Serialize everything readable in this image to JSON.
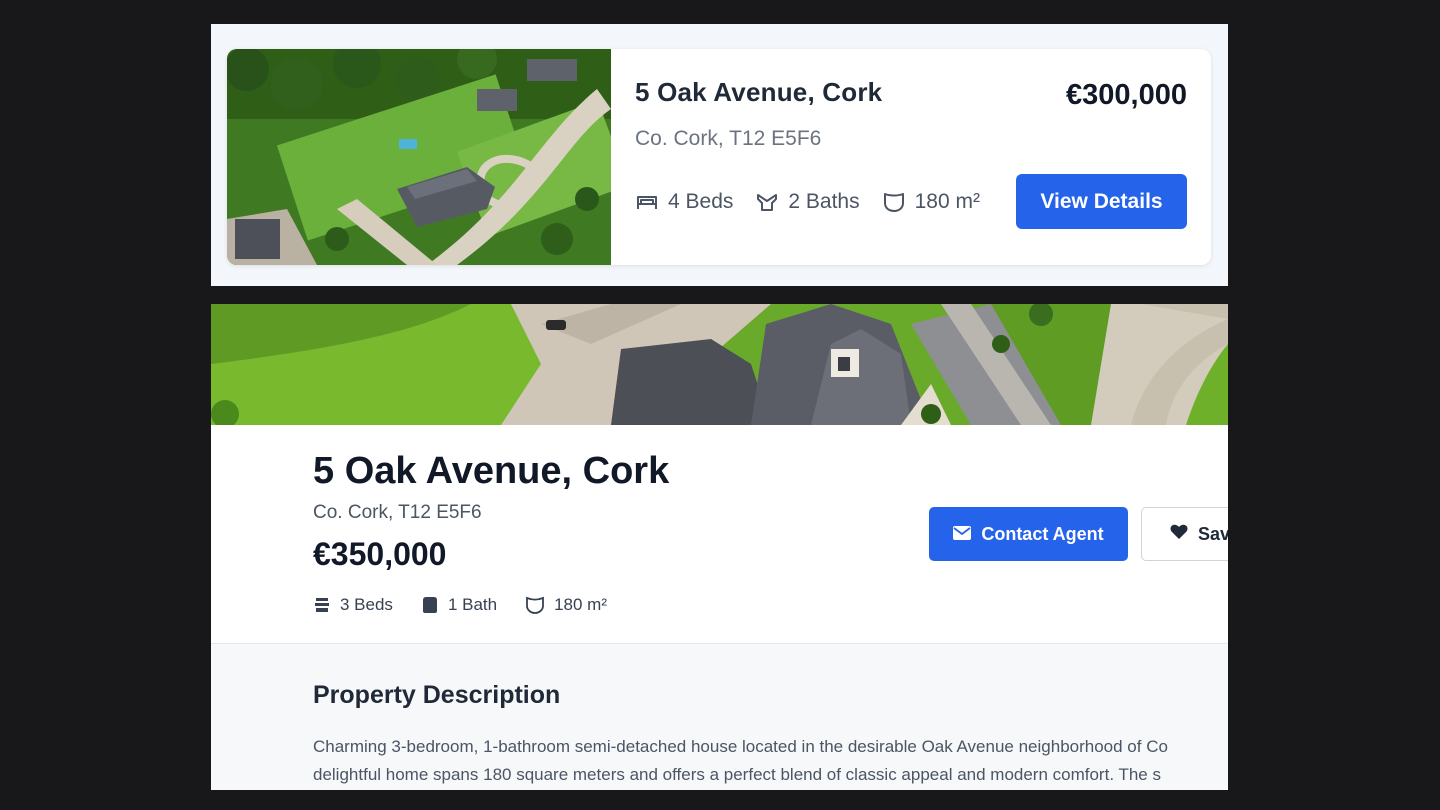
{
  "listing_card": {
    "address": "5 Oak Avenue, Cork",
    "subtitle": "Co. Cork, T12 E5F6",
    "price": "€300,000",
    "specs": {
      "beds": "4 Beds",
      "baths": "2 Baths",
      "area": "180 m²"
    },
    "view_button": "View Details",
    "icons": [
      "bed-icon",
      "bath-icon",
      "area-icon"
    ],
    "thumbnail": "aerial-estate-photo"
  },
  "detail_page": {
    "hero": "aerial-house-photo",
    "title": "5 Oak Avenue, Cork",
    "subtitle": "Co. Cork, T12 E5F6",
    "price": "€350,000",
    "specs": {
      "beds": "3 Beds",
      "baths": "1 Bath",
      "area": "180 m²"
    },
    "contact_button": "Contact Agent",
    "save_button": "Save",
    "icons": [
      "envelope-icon",
      "heart-icon",
      "bed-icon",
      "bath-icon",
      "area-icon"
    ],
    "description": {
      "heading": "Property Description",
      "line1": "Charming 3-bedroom, 1-bathroom semi-detached house located in the desirable Oak Avenue neighborhood of Co",
      "line2": "delightful home spans 180 square meters and offers a perfect blend of classic appeal and modern comfort. The s"
    }
  },
  "colors": {
    "accent": "#2563eb",
    "page_background": "#18181b",
    "text_dark": "#111827",
    "text_muted": "#6b7280"
  }
}
